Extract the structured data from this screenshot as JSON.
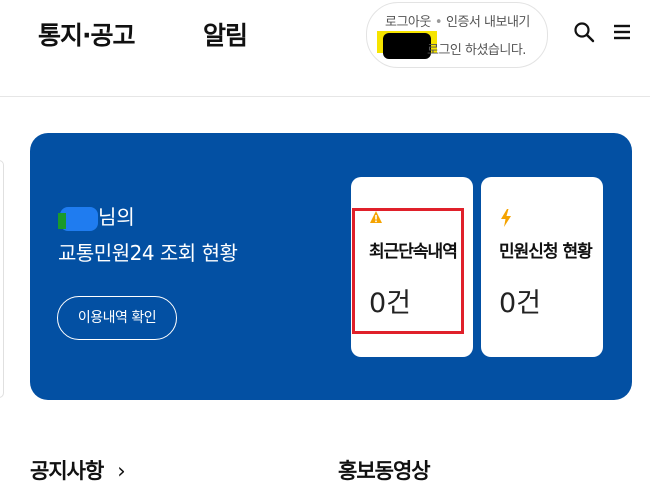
{
  "header": {
    "nav": [
      "통지·공고",
      "알림"
    ],
    "login": {
      "logout": "로그아웃",
      "separator": "•",
      "export_cert": "인증서 내보내기",
      "message": "로그인 하셨습니다."
    },
    "icons": [
      "search-icon",
      "menu-icon"
    ]
  },
  "status_panel": {
    "greeting_suffix": "님의",
    "title": "교통민원24 조회 현황",
    "usage_button": "이용내역 확인",
    "cards": [
      {
        "label": "최근단속내역",
        "count": "0건",
        "icon": "warning-icon",
        "icon_color": "#f5a300"
      },
      {
        "label": "민원신청 현황",
        "count": "0건",
        "icon": "lightning-icon",
        "icon_color": "#f5a300"
      }
    ],
    "background": "#0350a3"
  },
  "sections": {
    "notices": "공지사항",
    "notices_arrow": "›",
    "promo_video": "홍보동영상"
  }
}
